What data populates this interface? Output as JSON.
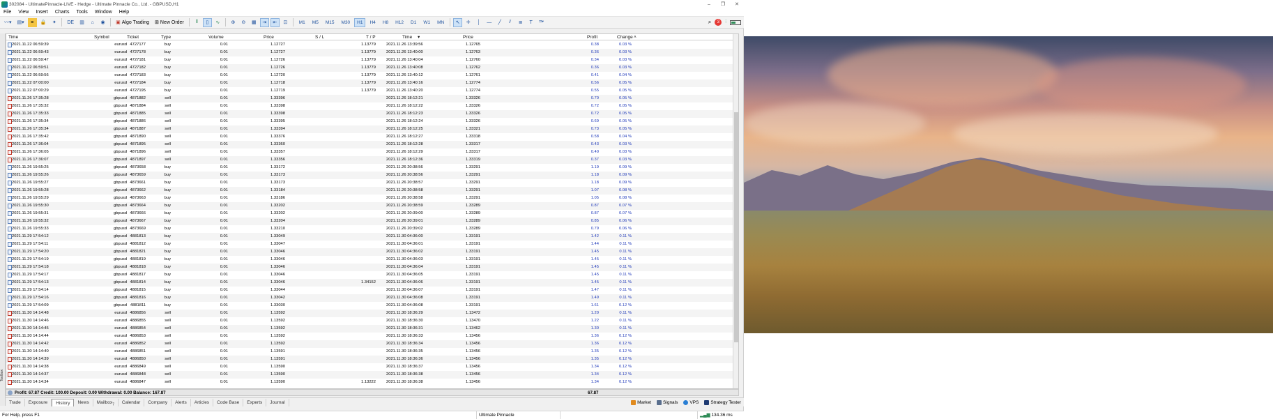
{
  "window": {
    "title": "302084 - UltimatePinnacle-LIVE - Hedge - Ultimate Pinnacle Co., Ltd. - GBPUSD,H1"
  },
  "menu": [
    "File",
    "View",
    "Insert",
    "Charts",
    "Tools",
    "Window",
    "Help"
  ],
  "toolbar": {
    "algo_trading_label": "Algo Trading",
    "new_order_label": "New Order",
    "timeframes": [
      "M1",
      "M5",
      "M15",
      "M30",
      "H1",
      "H4",
      "H8",
      "H12",
      "D1",
      "W1",
      "MN"
    ],
    "active_timeframe": "H1",
    "notification_count": "3"
  },
  "table": {
    "headers": [
      "Time",
      "Symbol",
      "Ticket",
      "Type",
      "Volume",
      "Price",
      "S / L",
      "T / P",
      "Time",
      "Price",
      "Profit",
      "Change"
    ],
    "rows": [
      [
        "2021.11.22 06:59:39",
        "eurusd",
        "4727177",
        "buy",
        "0.01",
        "1.12727",
        "",
        "1.13779",
        "2021.11.26 13:39:56",
        "1.12765",
        "0.38",
        "0.03 %"
      ],
      [
        "2021.11.22 06:59:43",
        "eurusd",
        "4727178",
        "buy",
        "0.01",
        "1.12727",
        "",
        "1.13779",
        "2021.11.26 13:40:00",
        "1.12763",
        "0.36",
        "0.03 %"
      ],
      [
        "2021.11.22 06:59:47",
        "eurusd",
        "4727181",
        "buy",
        "0.01",
        "1.12726",
        "",
        "1.13779",
        "2021.11.26 13:40:04",
        "1.12760",
        "0.34",
        "0.03 %"
      ],
      [
        "2021.11.22 06:59:51",
        "eurusd",
        "4727182",
        "buy",
        "0.01",
        "1.12726",
        "",
        "1.13779",
        "2021.11.26 13:40:08",
        "1.12762",
        "0.36",
        "0.03 %"
      ],
      [
        "2021.11.22 06:59:56",
        "eurusd",
        "4727183",
        "buy",
        "0.01",
        "1.12720",
        "",
        "1.13779",
        "2021.11.26 13:40:12",
        "1.12761",
        "0.41",
        "0.04 %"
      ],
      [
        "2021.11.22 07:00:00",
        "eurusd",
        "4727184",
        "buy",
        "0.01",
        "1.12718",
        "",
        "1.13779",
        "2021.11.26 13:40:16",
        "1.12774",
        "0.56",
        "0.05 %"
      ],
      [
        "2021.11.22 07:00:29",
        "eurusd",
        "4727195",
        "buy",
        "0.01",
        "1.12719",
        "",
        "1.13779",
        "2021.11.26 13:40:20",
        "1.12774",
        "0.55",
        "0.05 %"
      ],
      [
        "2021.11.26 17:35:28",
        "gbpusd",
        "4871882",
        "sell",
        "0.01",
        "1.33396",
        "",
        "",
        "2021.11.26 18:12:21",
        "1.33326",
        "0.70",
        "0.05 %"
      ],
      [
        "2021.11.26 17:35:32",
        "gbpusd",
        "4871884",
        "sell",
        "0.01",
        "1.33398",
        "",
        "",
        "2021.11.26 18:12:22",
        "1.33326",
        "0.72",
        "0.05 %"
      ],
      [
        "2021.11.26 17:35:33",
        "gbpusd",
        "4871885",
        "sell",
        "0.01",
        "1.33398",
        "",
        "",
        "2021.11.26 18:12:23",
        "1.33326",
        "0.72",
        "0.05 %"
      ],
      [
        "2021.11.26 17:35:34",
        "gbpusd",
        "4871886",
        "sell",
        "0.01",
        "1.33395",
        "",
        "",
        "2021.11.26 18:12:24",
        "1.33326",
        "0.69",
        "0.05 %"
      ],
      [
        "2021.11.26 17:35:34",
        "gbpusd",
        "4871887",
        "sell",
        "0.01",
        "1.33394",
        "",
        "",
        "2021.11.26 18:12:25",
        "1.33321",
        "0.73",
        "0.05 %"
      ],
      [
        "2021.11.26 17:35:42",
        "gbpusd",
        "4871890",
        "sell",
        "0.01",
        "1.33376",
        "",
        "",
        "2021.11.26 18:12:27",
        "1.33318",
        "0.58",
        "0.04 %"
      ],
      [
        "2021.11.26 17:36:04",
        "gbpusd",
        "4871895",
        "sell",
        "0.01",
        "1.33360",
        "",
        "",
        "2021.11.26 18:12:28",
        "1.33317",
        "0.43",
        "0.03 %"
      ],
      [
        "2021.11.26 17:36:05",
        "gbpusd",
        "4871896",
        "sell",
        "0.01",
        "1.33357",
        "",
        "",
        "2021.11.26 18:12:29",
        "1.33317",
        "0.40",
        "0.03 %"
      ],
      [
        "2021.11.26 17:36:07",
        "gbpusd",
        "4871897",
        "sell",
        "0.01",
        "1.33356",
        "",
        "",
        "2021.11.26 18:12:36",
        "1.33319",
        "0.37",
        "0.03 %"
      ],
      [
        "2021.11.26 19:55:25",
        "gbpusd",
        "4873658",
        "buy",
        "0.01",
        "1.33172",
        "",
        "",
        "2021.11.26 20:38:56",
        "1.33291",
        "1.19",
        "0.09 %"
      ],
      [
        "2021.11.26 19:55:26",
        "gbpusd",
        "4873659",
        "buy",
        "0.01",
        "1.33173",
        "",
        "",
        "2021.11.26 20:38:56",
        "1.33291",
        "1.18",
        "0.09 %"
      ],
      [
        "2021.11.26 19:55:27",
        "gbpusd",
        "4873661",
        "buy",
        "0.01",
        "1.33173",
        "",
        "",
        "2021.11.26 20:38:57",
        "1.33291",
        "1.18",
        "0.09 %"
      ],
      [
        "2021.11.26 19:55:28",
        "gbpusd",
        "4873662",
        "buy",
        "0.01",
        "1.33184",
        "",
        "",
        "2021.11.26 20:38:58",
        "1.33291",
        "1.07",
        "0.08 %"
      ],
      [
        "2021.11.26 19:55:29",
        "gbpusd",
        "4873663",
        "buy",
        "0.01",
        "1.33186",
        "",
        "",
        "2021.11.26 20:38:58",
        "1.33291",
        "1.05",
        "0.08 %"
      ],
      [
        "2021.11.26 19:55:30",
        "gbpusd",
        "4873664",
        "buy",
        "0.01",
        "1.33202",
        "",
        "",
        "2021.11.26 20:38:59",
        "1.33289",
        "0.87",
        "0.07 %"
      ],
      [
        "2021.11.26 19:55:31",
        "gbpusd",
        "4873666",
        "buy",
        "0.01",
        "1.33202",
        "",
        "",
        "2021.11.26 20:39:00",
        "1.33289",
        "0.87",
        "0.07 %"
      ],
      [
        "2021.11.26 19:55:32",
        "gbpusd",
        "4873667",
        "buy",
        "0.01",
        "1.33204",
        "",
        "",
        "2021.11.26 20:39:01",
        "1.33289",
        "0.85",
        "0.06 %"
      ],
      [
        "2021.11.26 19:55:33",
        "gbpusd",
        "4873669",
        "buy",
        "0.01",
        "1.33210",
        "",
        "",
        "2021.11.26 20:39:02",
        "1.33289",
        "0.79",
        "0.06 %"
      ],
      [
        "2021.11.29 17:54:12",
        "gbpusd",
        "4881813",
        "buy",
        "0.01",
        "1.33049",
        "",
        "",
        "2021.11.30 04:36:00",
        "1.33191",
        "1.42",
        "0.11 %"
      ],
      [
        "2021.11.29 17:54:11",
        "gbpusd",
        "4881812",
        "buy",
        "0.01",
        "1.33047",
        "",
        "",
        "2021.11.30 04:36:01",
        "1.33191",
        "1.44",
        "0.11 %"
      ],
      [
        "2021.11.29 17:54:20",
        "gbpusd",
        "4881821",
        "buy",
        "0.01",
        "1.33046",
        "",
        "",
        "2021.11.30 04:36:02",
        "1.33191",
        "1.45",
        "0.11 %"
      ],
      [
        "2021.11.29 17:54:19",
        "gbpusd",
        "4881819",
        "buy",
        "0.01",
        "1.33046",
        "",
        "",
        "2021.11.30 04:36:03",
        "1.33191",
        "1.45",
        "0.11 %"
      ],
      [
        "2021.11.29 17:54:18",
        "gbpusd",
        "4881818",
        "buy",
        "0.01",
        "1.33046",
        "",
        "",
        "2021.11.30 04:36:04",
        "1.33191",
        "1.45",
        "0.11 %"
      ],
      [
        "2021.11.29 17:54:17",
        "gbpusd",
        "4881817",
        "buy",
        "0.01",
        "1.33046",
        "",
        "",
        "2021.11.30 04:36:05",
        "1.33191",
        "1.45",
        "0.11 %"
      ],
      [
        "2021.11.29 17:54:13",
        "gbpusd",
        "4881814",
        "buy",
        "0.01",
        "1.33046",
        "",
        "1.34152",
        "2021.11.30 04:36:06",
        "1.33191",
        "1.45",
        "0.11 %"
      ],
      [
        "2021.11.29 17:54:14",
        "gbpusd",
        "4881815",
        "buy",
        "0.01",
        "1.33044",
        "",
        "",
        "2021.11.30 04:36:07",
        "1.33191",
        "1.47",
        "0.11 %"
      ],
      [
        "2021.11.29 17:54:16",
        "gbpusd",
        "4881816",
        "buy",
        "0.01",
        "1.33042",
        "",
        "",
        "2021.11.30 04:36:08",
        "1.33191",
        "1.49",
        "0.11 %"
      ],
      [
        "2021.11.29 17:54:09",
        "gbpusd",
        "4881811",
        "buy",
        "0.01",
        "1.33030",
        "",
        "",
        "2021.11.30 04:36:08",
        "1.33191",
        "1.61",
        "0.12 %"
      ],
      [
        "2021.11.30 14:14:48",
        "eurusd",
        "4886856",
        "sell",
        "0.01",
        "1.13592",
        "",
        "",
        "2021.11.30 18:36:29",
        "1.13472",
        "1.20",
        "0.11 %"
      ],
      [
        "2021.11.30 14:14:46",
        "eurusd",
        "4886855",
        "sell",
        "0.01",
        "1.13592",
        "",
        "",
        "2021.11.30 18:36:30",
        "1.13470",
        "1.22",
        "0.11 %"
      ],
      [
        "2021.11.30 14:14:45",
        "eurusd",
        "4886854",
        "sell",
        "0.01",
        "1.13592",
        "",
        "",
        "2021.11.30 18:36:31",
        "1.13462",
        "1.30",
        "0.11 %"
      ],
      [
        "2021.11.30 14:14:44",
        "eurusd",
        "4886853",
        "sell",
        "0.01",
        "1.13592",
        "",
        "",
        "2021.11.30 18:36:33",
        "1.13456",
        "1.36",
        "0.12 %"
      ],
      [
        "2021.11.30 14:14:42",
        "eurusd",
        "4886852",
        "sell",
        "0.01",
        "1.13592",
        "",
        "",
        "2021.11.30 18:36:34",
        "1.13456",
        "1.36",
        "0.12 %"
      ],
      [
        "2021.11.30 14:14:40",
        "eurusd",
        "4886851",
        "sell",
        "0.01",
        "1.13591",
        "",
        "",
        "2021.11.30 18:36:35",
        "1.13456",
        "1.35",
        "0.12 %"
      ],
      [
        "2021.11.30 14:14:39",
        "eurusd",
        "4886850",
        "sell",
        "0.01",
        "1.13591",
        "",
        "",
        "2021.11.30 18:36:36",
        "1.13456",
        "1.35",
        "0.12 %"
      ],
      [
        "2021.11.30 14:14:38",
        "eurusd",
        "4886849",
        "sell",
        "0.01",
        "1.13590",
        "",
        "",
        "2021.11.30 18:36:37",
        "1.13456",
        "1.34",
        "0.12 %"
      ],
      [
        "2021.11.30 14:14:37",
        "eurusd",
        "4886848",
        "sell",
        "0.01",
        "1.13590",
        "",
        "",
        "2021.11.30 18:36:38",
        "1.13456",
        "1.34",
        "0.12 %"
      ],
      [
        "2021.11.30 14:14:34",
        "eurusd",
        "4886847",
        "sell",
        "0.01",
        "1.13590",
        "",
        "1.13222",
        "2021.11.30 18:36:38",
        "1.13456",
        "1.34",
        "0.12 %"
      ]
    ]
  },
  "summary": {
    "text": "Profit: 67.87  Credit: 100.00  Deposit: 0.00  Withdrawal: 0.00  Balance: 167.87",
    "total": "67.87"
  },
  "tabs": [
    "Trade",
    "Exposure",
    "History",
    "News",
    "Mailbox",
    "Calendar",
    "Company",
    "Alerts",
    "Articles",
    "Code Base",
    "Experts",
    "Journal"
  ],
  "active_tab": "History",
  "mailbox_badge": "7",
  "right_tabs": [
    "Market",
    "Signals",
    "VPS",
    "Strategy Tester"
  ],
  "toolbox_label": "Toolbox",
  "status": {
    "help": "For Help, press F1",
    "broker": "Ultimate Pinnacle",
    "ping": "134.36 ms"
  },
  "colors": {
    "profit_text": "#1e38b9",
    "selection": "#cde2f7",
    "grid_alt_row": "#f4f4f4"
  },
  "icons": [
    "search-icon",
    "notification-icon",
    "signal-strength-icon",
    "battery-icon"
  ]
}
